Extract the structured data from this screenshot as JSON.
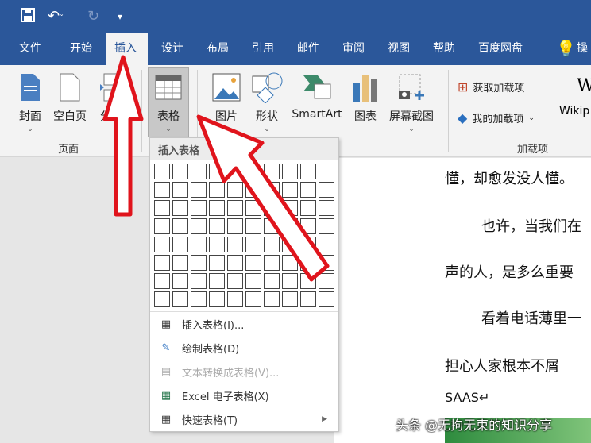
{
  "quick_access": {
    "save": "save-icon",
    "undo": "undo-icon",
    "redo": "redo-icon",
    "customize": "▾"
  },
  "tabs": [
    "文件",
    "开始",
    "插入",
    "设计",
    "布局",
    "引用",
    "邮件",
    "审阅",
    "视图",
    "帮助",
    "百度网盘",
    "操作"
  ],
  "active_tab": "插入",
  "ribbon": {
    "pages_group": {
      "label": "页面",
      "buttons": [
        "封面",
        "空白页",
        "分页"
      ]
    },
    "table_button": "表格",
    "illustrations": [
      "图片",
      "形状",
      "SmartArt",
      "图表",
      "屏幕截图"
    ],
    "addins_group": {
      "label": "加载项",
      "get": "获取加载项",
      "mine": "我的加载项",
      "wiki": "Wikip"
    }
  },
  "dropdown": {
    "header": "插入表格",
    "grid": {
      "columns": 10,
      "rows": 8
    },
    "items": [
      {
        "label": "插入表格(I)...",
        "disabled": false
      },
      {
        "label": "绘制表格(D)",
        "disabled": false
      },
      {
        "label": "文本转换成表格(V)...",
        "disabled": true
      },
      {
        "label": "Excel 电子表格(X)",
        "disabled": false
      },
      {
        "label": "快速表格(T)",
        "disabled": false,
        "submenu": true
      }
    ]
  },
  "document": {
    "lines": [
      "懂，却愈发没人懂。",
      "也许，当我们在",
      "声的人，是多么重要",
      "看着电话薄里一",
      "担心人家根本不屑",
      "SAAS↵"
    ]
  },
  "watermark": "头条 @无拘无束的知识分享"
}
